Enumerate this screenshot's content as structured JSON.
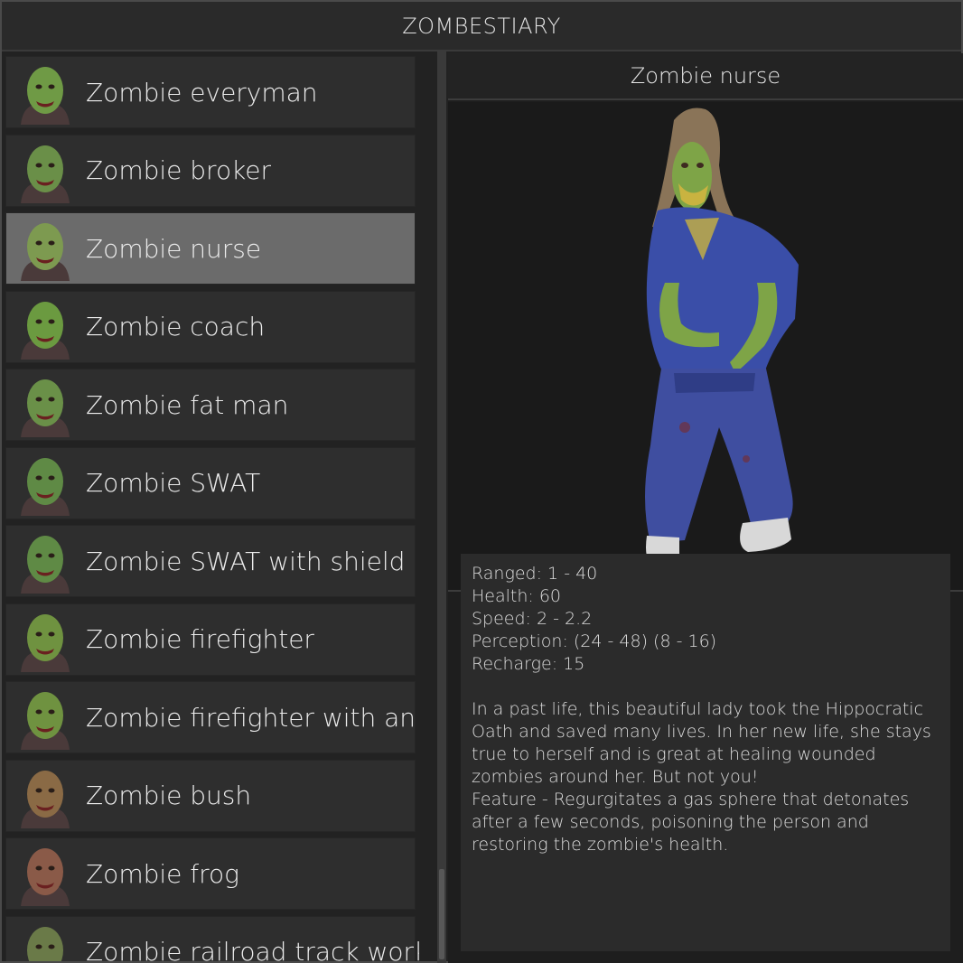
{
  "app": {
    "title": "ZOMBESTIARY"
  },
  "list": {
    "items": [
      {
        "label": "Zombie everyman",
        "icon": "zombie-everyman-portrait-icon"
      },
      {
        "label": "Zombie broker",
        "icon": "zombie-broker-portrait-icon"
      },
      {
        "label": "Zombie nurse",
        "icon": "zombie-nurse-portrait-icon",
        "selected": true
      },
      {
        "label": "Zombie coach",
        "icon": "zombie-coach-portrait-icon"
      },
      {
        "label": "Zombie fat man",
        "icon": "zombie-fat-man-portrait-icon"
      },
      {
        "label": "Zombie SWAT",
        "icon": "zombie-swat-portrait-icon"
      },
      {
        "label": "Zombie SWAT with shield",
        "icon": "zombie-swat-shield-portrait-icon"
      },
      {
        "label": "Zombie firefighter",
        "icon": "zombie-firefighter-portrait-icon"
      },
      {
        "label": "Zombie firefighter with an ax",
        "icon": "zombie-firefighter-ax-portrait-icon"
      },
      {
        "label": "Zombie bush",
        "icon": "zombie-bush-portrait-icon"
      },
      {
        "label": "Zombie frog",
        "icon": "zombie-frog-portrait-icon"
      },
      {
        "label": "Zombie railroad track worker",
        "icon": "zombie-railroad-worker-portrait-icon"
      }
    ]
  },
  "detail": {
    "name": "Zombie nurse",
    "stats": {
      "ranged": "Ranged: 1 - 40",
      "health": "Health: 60",
      "speed": "Speed: 2 - 2.2",
      "perception": "Perception: (24 - 48) (8 - 16)",
      "recharge": "Recharge: 15"
    },
    "description": "In a past life, this beautiful lady took the Hippocratic\nOath and saved many lives. In her new life, she stays\ntrue to herself and is great at healing wounded\nzombies around her. But not you!\nFeature - Regurgitates a gas sphere that detonates\nafter a few seconds, poisoning the person and\nrestoring the zombie's health."
  },
  "colors": {
    "selected_row": "#6b6b6b",
    "row": "#2e2e2e",
    "zombie_skin": "#6f9a45",
    "scrubs": "#3a4ea8"
  }
}
